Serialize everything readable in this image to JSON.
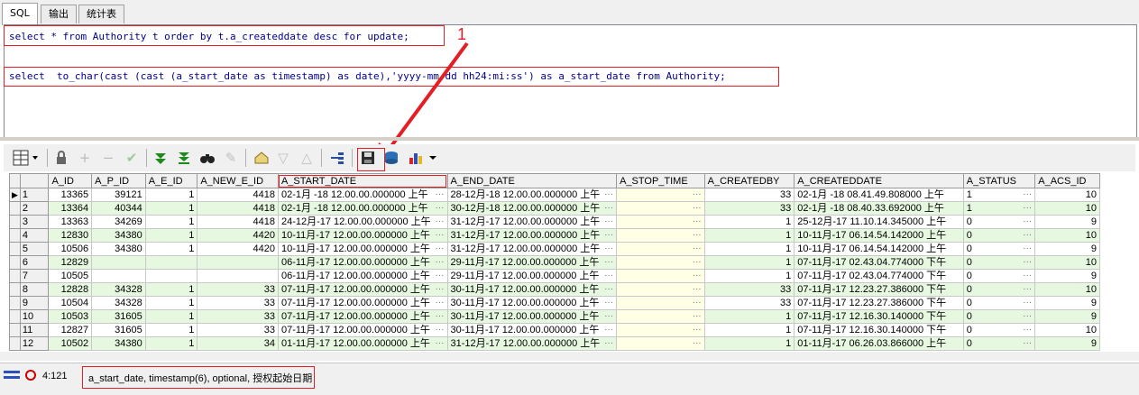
{
  "tabs": [
    "SQL",
    "输出",
    "统计表"
  ],
  "editor": {
    "line1": "select * from Authority t order by t.a_createddate desc for update;",
    "line2": "select  to_char(cast (cast (a_start_date as timestamp) as date),'yyyy-mm-dd hh24:mi:ss') as a_start_date from Authority;"
  },
  "annotation_label": "1",
  "grid": {
    "columns": [
      "A_ID",
      "A_P_ID",
      "A_E_ID",
      "A_NEW_E_ID",
      "A_START_DATE",
      "A_END_DATE",
      "A_STOP_TIME",
      "A_CREATEDBY",
      "A_CREATEDDATE",
      "A_STATUS",
      "A_ACS_ID"
    ],
    "rows": [
      [
        "1",
        "13365",
        "39121",
        "1",
        "4418",
        "02-1月 -18 12.00.00.000000 上午",
        "28-12月-18 12.00.00.000000 上午",
        "",
        "33",
        "02-1月 -18 08.41.49.808000 上午",
        "1",
        "10"
      ],
      [
        "2",
        "13364",
        "40344",
        "1",
        "4418",
        "02-1月 -18 12.00.00.000000 上午",
        "30-12月-18 12.00.00.000000 上午",
        "",
        "33",
        "02-1月 -18 08.40.33.692000 上午",
        "1",
        "10"
      ],
      [
        "3",
        "13363",
        "34269",
        "1",
        "4418",
        "24-12月-17 12.00.00.000000 上午",
        "31-12月-17 12.00.00.000000 上午",
        "",
        "1",
        "25-12月-17 11.10.14.345000 上午",
        "0",
        "9"
      ],
      [
        "4",
        "12830",
        "34380",
        "1",
        "4420",
        "10-11月-17 12.00.00.000000 上午",
        "31-12月-17 12.00.00.000000 上午",
        "",
        "1",
        "10-11月-17 06.14.54.142000 上午",
        "0",
        "10"
      ],
      [
        "5",
        "10506",
        "34380",
        "1",
        "4420",
        "10-11月-17 12.00.00.000000 上午",
        "31-12月-17 12.00.00.000000 上午",
        "",
        "1",
        "10-11月-17 06.14.54.142000 上午",
        "0",
        "9"
      ],
      [
        "6",
        "12829",
        "",
        "",
        "",
        "06-11月-17 12.00.00.000000 上午",
        "29-11月-17 12.00.00.000000 上午",
        "",
        "1",
        "07-11月-17 02.43.04.774000 下午",
        "0",
        "10"
      ],
      [
        "7",
        "10505",
        "",
        "",
        "",
        "06-11月-17 12.00.00.000000 上午",
        "29-11月-17 12.00.00.000000 上午",
        "",
        "1",
        "07-11月-17 02.43.04.774000 下午",
        "0",
        "9"
      ],
      [
        "8",
        "12828",
        "34328",
        "1",
        "33",
        "07-11月-17 12.00.00.000000 上午",
        "30-11月-17 12.00.00.000000 上午",
        "",
        "33",
        "07-11月-17 12.23.27.386000 下午",
        "0",
        "10"
      ],
      [
        "9",
        "10504",
        "34328",
        "1",
        "33",
        "07-11月-17 12.00.00.000000 上午",
        "30-11月-17 12.00.00.000000 上午",
        "",
        "33",
        "07-11月-17 12.23.27.386000 下午",
        "0",
        "9"
      ],
      [
        "10",
        "10503",
        "31605",
        "1",
        "33",
        "07-11月-17 12.00.00.000000 上午",
        "30-11月-17 12.00.00.000000 上午",
        "",
        "1",
        "07-11月-17 12.16.30.140000 下午",
        "0",
        "9"
      ],
      [
        "11",
        "12827",
        "31605",
        "1",
        "33",
        "07-11月-17 12.00.00.000000 上午",
        "30-11月-17 12.00.00.000000 上午",
        "",
        "1",
        "07-11月-17 12.16.30.140000 下午",
        "0",
        "10"
      ],
      [
        "12",
        "10502",
        "34380",
        "1",
        "34",
        "01-11月-17 12.00.00.000000 上午",
        "31-12月-17 12.00.00.000000 上午",
        "",
        "1",
        "01-11月-17 06.26.03.866000 上午",
        "0",
        "9"
      ]
    ]
  },
  "status": {
    "position": "4:121",
    "hint": "a_start_date, timestamp(6), optional, 授权起始日期"
  },
  "colors": {
    "annotation_red": "#e31e24",
    "row_green": "#e7f8e1",
    "sql_blue": "#00008b"
  }
}
